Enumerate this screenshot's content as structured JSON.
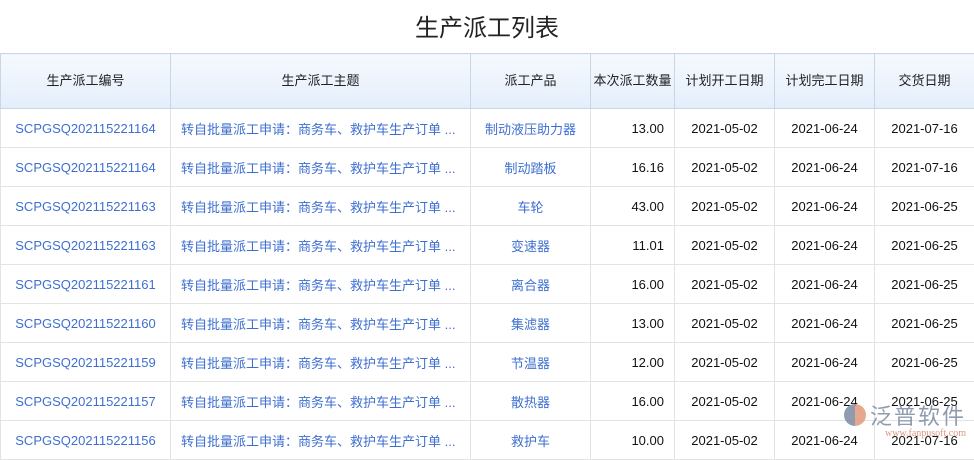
{
  "title": "生产派工列表",
  "columns": [
    "生产派工编号",
    "生产派工主题",
    "派工产品",
    "本次派工数量",
    "计划开工日期",
    "计划完工日期",
    "交货日期"
  ],
  "rows": [
    [
      "SCPGSQ202115221164",
      "转自批量派工申请：商务车、救护车生产订单 ...",
      "制动液压助力器",
      "13.00",
      "2021-05-02",
      "2021-06-24",
      "2021-07-16"
    ],
    [
      "SCPGSQ202115221164",
      "转自批量派工申请：商务车、救护车生产订单 ...",
      "制动踏板",
      "16.16",
      "2021-05-02",
      "2021-06-24",
      "2021-07-16"
    ],
    [
      "SCPGSQ202115221163",
      "转自批量派工申请：商务车、救护车生产订单 ...",
      "车轮",
      "43.00",
      "2021-05-02",
      "2021-06-24",
      "2021-06-25"
    ],
    [
      "SCPGSQ202115221163",
      "转自批量派工申请：商务车、救护车生产订单 ...",
      "变速器",
      "11.01",
      "2021-05-02",
      "2021-06-24",
      "2021-06-25"
    ],
    [
      "SCPGSQ202115221161",
      "转自批量派工申请：商务车、救护车生产订单 ...",
      "离合器",
      "16.00",
      "2021-05-02",
      "2021-06-24",
      "2021-06-25"
    ],
    [
      "SCPGSQ202115221160",
      "转自批量派工申请：商务车、救护车生产订单 ...",
      "集滤器",
      "13.00",
      "2021-05-02",
      "2021-06-24",
      "2021-06-25"
    ],
    [
      "SCPGSQ202115221159",
      "转自批量派工申请：商务车、救护车生产订单 ...",
      "节温器",
      "12.00",
      "2021-05-02",
      "2021-06-24",
      "2021-06-25"
    ],
    [
      "SCPGSQ202115221157",
      "转自批量派工申请：商务车、救护车生产订单 ...",
      "散热器",
      "16.00",
      "2021-05-02",
      "2021-06-24",
      "2021-06-25"
    ],
    [
      "SCPGSQ202115221156",
      "转自批量派工申请：商务车、救护车生产订单 ...",
      "救护车",
      "10.00",
      "2021-05-02",
      "2021-06-24",
      "2021-07-16"
    ]
  ],
  "watermark": {
    "name": "泛普软件",
    "url": "www.fanpusoft.com"
  }
}
